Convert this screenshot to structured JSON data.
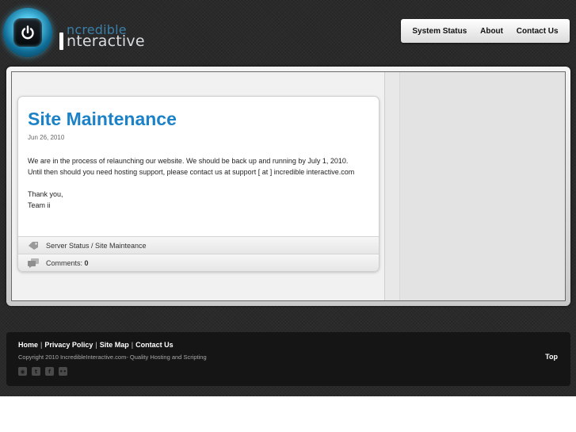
{
  "header": {
    "logo_word1": "ncredible",
    "logo_word2": "nteractive",
    "nav": [
      {
        "label": "System Status"
      },
      {
        "label": "About"
      },
      {
        "label": "Contact Us"
      }
    ]
  },
  "post": {
    "title": "Site Maintenance",
    "date": "Jun 26, 2010",
    "body": [
      "We  are in the process of relaunching our website.  We should be back up and running by July 1, 2010.",
      "Until then should you need hosting support, please contact us at support [ at ] incredible interactive.com",
      "",
      "Thank you,",
      "Team ii"
    ],
    "categories": "Server Status / Site Mainteance",
    "comments_label": "Comments: ",
    "comments_count": "0"
  },
  "footer": {
    "links": [
      {
        "label": "Home"
      },
      {
        "label": "Privacy Policy"
      },
      {
        "label": "Site Map"
      },
      {
        "label": "Contact Us"
      }
    ],
    "separator": "|",
    "copyright": "Copyright 2010 IncredibleInteractive.com- Quality Hosting and Scripting",
    "top_label": "Top",
    "social": [
      {
        "icon": "rss-icon"
      },
      {
        "icon": "twitter-icon"
      },
      {
        "icon": "facebook-icon"
      },
      {
        "icon": "flickr-icon"
      }
    ]
  },
  "colors": {
    "background": "#2a2a2a",
    "title_blue": "#1c82c7",
    "footer_bg": "#151515"
  }
}
